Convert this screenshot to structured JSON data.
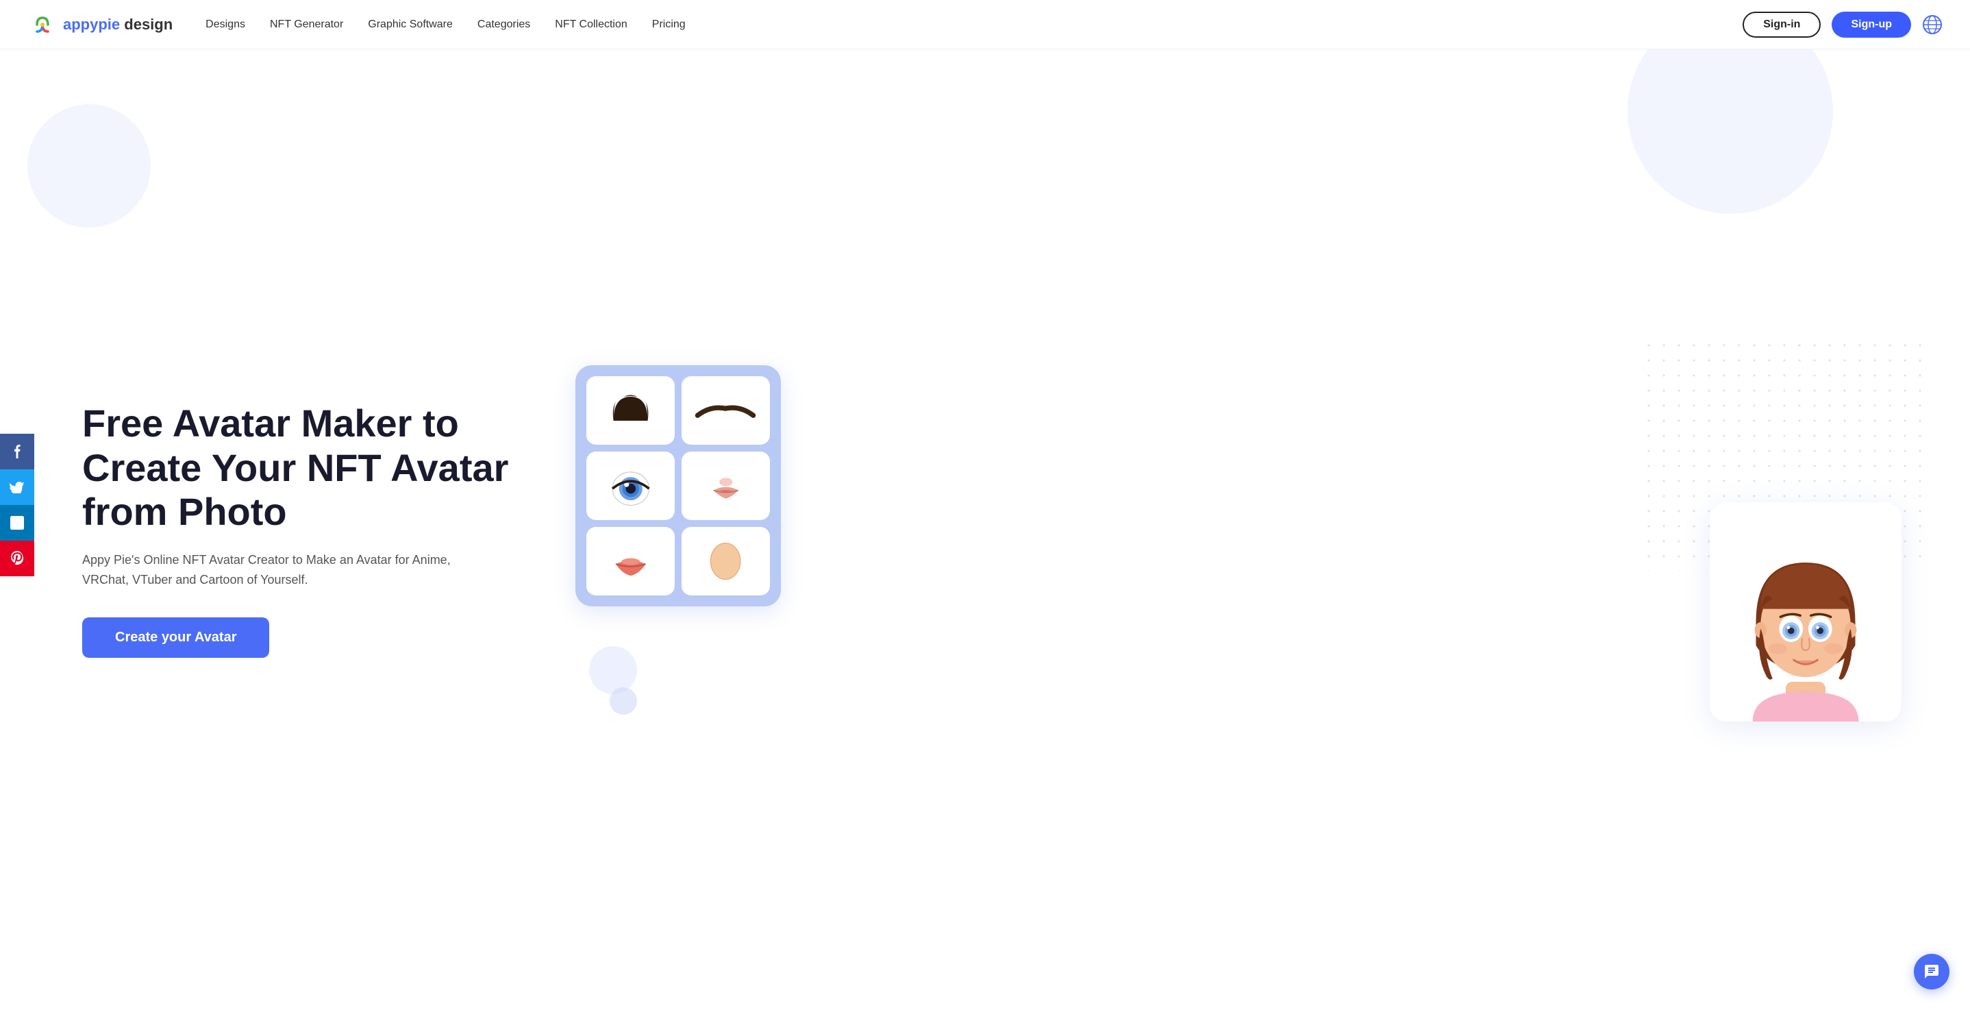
{
  "navbar": {
    "logo_text_1": "appypie",
    "logo_text_2": "design",
    "nav_links": [
      {
        "id": "designs",
        "label": "Designs"
      },
      {
        "id": "nft-generator",
        "label": "NFT Generator"
      },
      {
        "id": "graphic-software",
        "label": "Graphic Software"
      },
      {
        "id": "categories",
        "label": "Categories"
      },
      {
        "id": "nft-collection",
        "label": "NFT Collection"
      },
      {
        "id": "pricing",
        "label": "Pricing"
      }
    ],
    "signin_label": "Sign-in",
    "signup_label": "Sign-up"
  },
  "social": {
    "facebook": "f",
    "twitter": "t",
    "linkedin": "in",
    "pinterest": "p"
  },
  "hero": {
    "title": "Free Avatar Maker to Create Your NFT Avatar from Photo",
    "subtitle": "Appy Pie's Online NFT Avatar Creator to Make an Avatar for Anime, VRChat, VTuber and Cartoon of Yourself.",
    "cta_label": "Create your Avatar"
  },
  "chat": {
    "icon": "💬"
  }
}
